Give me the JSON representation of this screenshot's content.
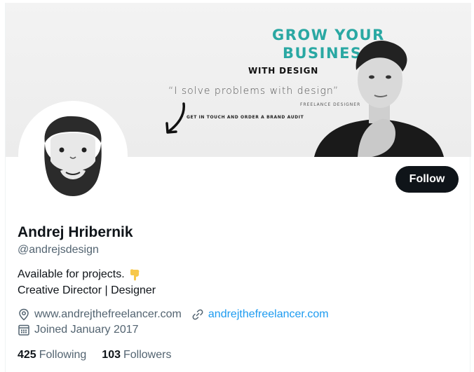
{
  "banner": {
    "headline_line1": "GROW YOUR",
    "headline_line2": "BUSINESS",
    "headline_line3": "WITH DESIGN",
    "quote": "“I solve problems with design”",
    "role": "FREELANCE DESIGNER",
    "cta": "GET IN TOUCH AND ORDER A BRAND AUDIT",
    "accent_color": "#2aa8a3"
  },
  "profile": {
    "name": "Andrej Hribernik",
    "handle": "@andrejsdesign",
    "bio_line1": "Available for projects.",
    "bio_emoji": "point-down-hand",
    "bio_line2": "Creative Director | Designer",
    "location": "www.andrejthefreelancer.com",
    "website": "andrejthefreelancer.com",
    "joined": "Joined January 2017"
  },
  "actions": {
    "follow_label": "Follow"
  },
  "stats": {
    "following_count": "425",
    "following_label": "Following",
    "followers_count": "103",
    "followers_label": "Followers"
  },
  "icons": {
    "location": "location-pin-icon",
    "link": "link-icon",
    "calendar": "calendar-icon"
  },
  "colors": {
    "text": "#0f1419",
    "secondary": "#536471",
    "link": "#1d9bf0",
    "button_bg": "#0f1419"
  }
}
